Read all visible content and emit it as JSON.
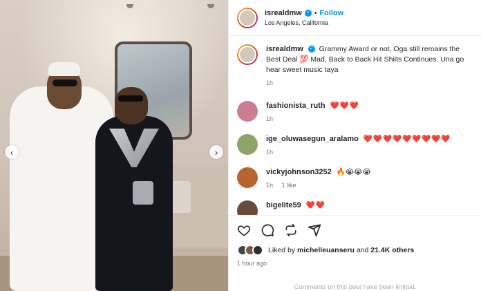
{
  "post": {
    "author": "isrealdmw",
    "follow_label": "Follow",
    "separator": "•",
    "location": "Los Angeles, California",
    "verified_badge": "✓",
    "prev_arrow": "‹",
    "next_arrow": "›"
  },
  "caption": {
    "author": "isrealdmw",
    "text": "Grammy Award or not, Oga still remains the Best Deal 💯 Mad, Back to Back Hit Shiits Continues. Una go hear sweet music taya",
    "time": "1h"
  },
  "comments": [
    {
      "author": "fashionista_ruth",
      "text": "❤️❤️❤️",
      "time": "1h",
      "likes": ""
    },
    {
      "author": "ige_oluwasegun_aralamo",
      "text": "❤️❤️❤️❤️❤️❤️❤️❤️❤️",
      "time": "1h",
      "likes": ""
    },
    {
      "author": "vickyjohnson3252",
      "text": "🔥😭😭😭",
      "time": "1h",
      "likes": "1 like"
    },
    {
      "author": "bigelite59",
      "text": "❤️❤️",
      "time": "",
      "likes": ""
    }
  ],
  "actions": {
    "like_icon": "heart-icon",
    "comment_icon": "comment-icon",
    "share_icon": "repost-icon",
    "send_icon": "send-icon"
  },
  "likes": {
    "prefix": "Liked by",
    "user": "michelleuanseru",
    "conj": "and",
    "others": "21.4K others"
  },
  "time_ago": "1 hour ago",
  "comments_limited": "Comments on this post have been limited."
}
